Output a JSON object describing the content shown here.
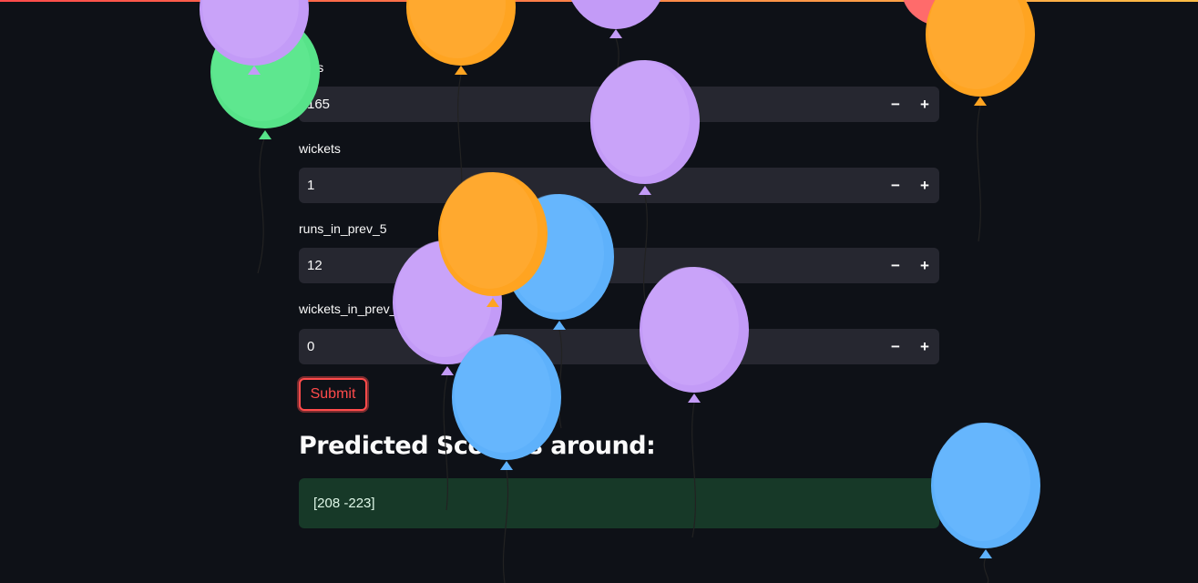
{
  "form": {
    "fields": [
      {
        "label": "runs",
        "value": "165"
      },
      {
        "label": "wickets",
        "value": "1"
      },
      {
        "label": "runs_in_prev_5",
        "value": "12"
      },
      {
        "label": "wickets_in_prev_5",
        "value": "0"
      }
    ],
    "decrement_symbol": "−",
    "increment_symbol": "+",
    "submit_label": "Submit"
  },
  "result": {
    "heading": "Predicted Score is around:",
    "value": "[208 -223]"
  },
  "colors": {
    "background": "#0e1117",
    "input_bg": "#262730",
    "accent": "#ff4b4b",
    "success_bg": "#173928",
    "balloon_purple": "#c39bf7",
    "balloon_orange": "#ffa421",
    "balloon_blue": "#5eb1fb",
    "balloon_green": "#57e389",
    "balloon_red": "#ff6b6b"
  },
  "icons": [
    "balloon-icon",
    "minus-icon",
    "plus-icon"
  ]
}
